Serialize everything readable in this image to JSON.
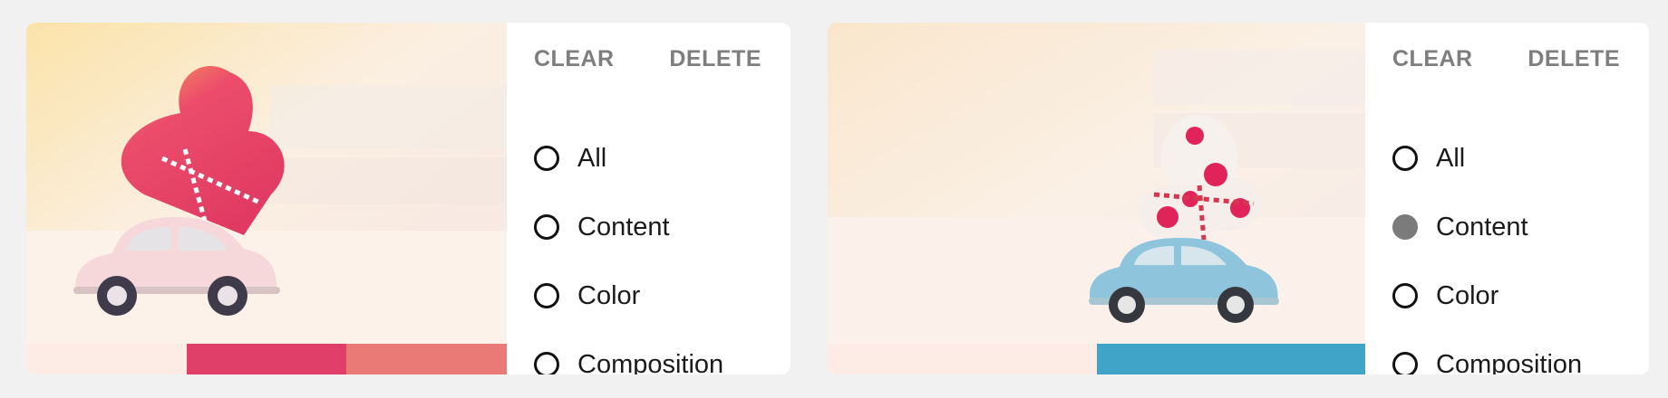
{
  "cards": [
    {
      "image": "photo of toy pink car carrying red heart",
      "swatches": [
        "#fdece6",
        "#df3f69",
        "#e97a75"
      ],
      "actions": {
        "clear": "CLEAR",
        "delete": "DELETE"
      },
      "options": [
        {
          "label": "All",
          "selected": false
        },
        {
          "label": "Content",
          "selected": false
        },
        {
          "label": "Color",
          "selected": false
        },
        {
          "label": "Composition",
          "selected": false
        }
      ]
    },
    {
      "image": "photo of toy blue car carrying polka-dot hearts",
      "swatches": [
        "#fdece6",
        "#3fa4c7"
      ],
      "actions": {
        "clear": "CLEAR",
        "delete": "DELETE"
      },
      "options": [
        {
          "label": "All",
          "selected": false
        },
        {
          "label": "Content",
          "selected": true
        },
        {
          "label": "Color",
          "selected": false
        },
        {
          "label": "Composition",
          "selected": false
        }
      ]
    }
  ]
}
